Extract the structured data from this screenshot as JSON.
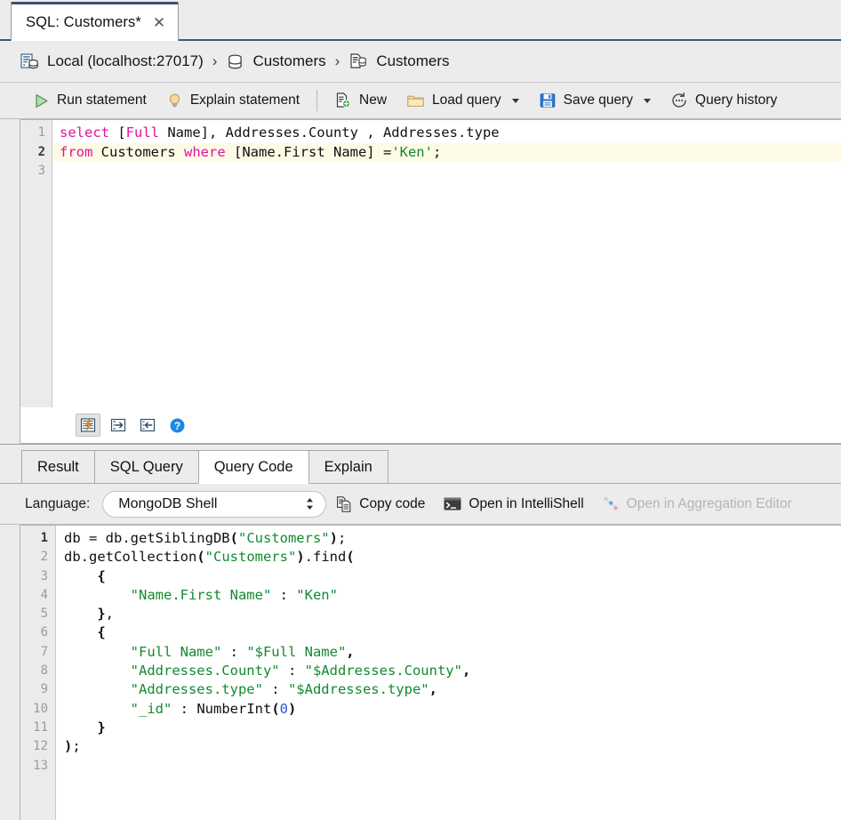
{
  "window": {
    "tab": {
      "label": "SQL: Customers*",
      "close_icon": "close-icon"
    }
  },
  "breadcrumb": {
    "items": [
      {
        "icon": "server-database-icon",
        "label": "Local (localhost:27017)"
      },
      {
        "icon": "database-icon",
        "label": "Customers"
      },
      {
        "icon": "collection-icon",
        "label": "Customers"
      }
    ],
    "separator": "›"
  },
  "toolbar": {
    "run_label": "Run statement",
    "explain_label": "Explain statement",
    "new_label": "New",
    "load_query_label": "Load query",
    "save_query_label": "Save query",
    "query_history_label": "Query history"
  },
  "sql_editor": {
    "line_numbers": [
      "1",
      "2",
      "3"
    ],
    "current_line": 2,
    "lines": [
      [
        {
          "t": "select ",
          "c": "kw"
        },
        {
          "t": "[",
          "c": "brk"
        },
        {
          "t": "Full",
          "c": "kw"
        },
        {
          "t": " Name], Addresses.County , Addresses.type",
          "c": "plain"
        }
      ],
      [
        {
          "t": "from ",
          "c": "kw"
        },
        {
          "t": "Customers ",
          "c": "plain"
        },
        {
          "t": "where ",
          "c": "kw"
        },
        {
          "t": "[Name.First Name] =",
          "c": "plain"
        },
        {
          "t": "'Ken'",
          "c": "str"
        },
        {
          "t": ";",
          "c": "plain"
        }
      ],
      []
    ],
    "footer_icons": [
      {
        "name": "format-query-icon",
        "selected": true
      },
      {
        "name": "indent-right-icon",
        "selected": false
      },
      {
        "name": "indent-left-icon",
        "selected": false
      },
      {
        "name": "help-icon",
        "selected": false
      }
    ]
  },
  "result_panel": {
    "tabs": [
      {
        "label": "Result",
        "active": false
      },
      {
        "label": "SQL Query",
        "active": false
      },
      {
        "label": "Query Code",
        "active": true
      },
      {
        "label": "Explain",
        "active": false
      }
    ],
    "language_label": "Language:",
    "language_value": "MongoDB Shell",
    "actions": [
      {
        "label": "Copy code",
        "icon": "copy-icon",
        "disabled": false
      },
      {
        "label": "Open in IntelliShell",
        "icon": "terminal-icon",
        "disabled": false
      },
      {
        "label": "Open in Aggregation Editor",
        "icon": "aggregation-icon",
        "disabled": true
      }
    ]
  },
  "query_code": {
    "line_numbers": [
      "1",
      "2",
      "3",
      "4",
      "5",
      "6",
      "7",
      "8",
      "9",
      "10",
      "11",
      "12",
      "13"
    ],
    "current_line": 1,
    "lines": [
      [
        {
          "t": "db = db.getSiblingDB",
          "c": "plain"
        },
        {
          "t": "(",
          "c": "bold"
        },
        {
          "t": "\"Customers\"",
          "c": "str"
        },
        {
          "t": ")",
          "c": "bold"
        },
        {
          "t": ";",
          "c": "plain"
        }
      ],
      [
        {
          "t": "db.getCollection",
          "c": "plain"
        },
        {
          "t": "(",
          "c": "bold"
        },
        {
          "t": "\"Customers\"",
          "c": "str"
        },
        {
          "t": ")",
          "c": "bold"
        },
        {
          "t": ".find",
          "c": "plain"
        },
        {
          "t": "(",
          "c": "bold"
        }
      ],
      [
        {
          "t": "    ",
          "c": "plain"
        },
        {
          "t": "{",
          "c": "bold"
        }
      ],
      [
        {
          "t": "        ",
          "c": "plain"
        },
        {
          "t": "\"Name.First Name\"",
          "c": "str"
        },
        {
          "t": " : ",
          "c": "plain"
        },
        {
          "t": "\"Ken\"",
          "c": "str"
        }
      ],
      [
        {
          "t": "    ",
          "c": "plain"
        },
        {
          "t": "}",
          "c": "bold"
        },
        {
          "t": ",",
          "c": "plain"
        }
      ],
      [
        {
          "t": "    ",
          "c": "plain"
        },
        {
          "t": "{",
          "c": "bold"
        }
      ],
      [
        {
          "t": "        ",
          "c": "plain"
        },
        {
          "t": "\"Full Name\"",
          "c": "str"
        },
        {
          "t": " : ",
          "c": "plain"
        },
        {
          "t": "\"$Full Name\"",
          "c": "str"
        },
        {
          "t": ",",
          "c": "bold"
        }
      ],
      [
        {
          "t": "        ",
          "c": "plain"
        },
        {
          "t": "\"Addresses.County\"",
          "c": "str"
        },
        {
          "t": " : ",
          "c": "plain"
        },
        {
          "t": "\"$Addresses.County\"",
          "c": "str"
        },
        {
          "t": ",",
          "c": "bold"
        }
      ],
      [
        {
          "t": "        ",
          "c": "plain"
        },
        {
          "t": "\"Addresses.type\"",
          "c": "str"
        },
        {
          "t": " : ",
          "c": "plain"
        },
        {
          "t": "\"$Addresses.type\"",
          "c": "str"
        },
        {
          "t": ",",
          "c": "bold"
        }
      ],
      [
        {
          "t": "        ",
          "c": "plain"
        },
        {
          "t": "\"_id\"",
          "c": "str"
        },
        {
          "t": " : NumberInt",
          "c": "plain"
        },
        {
          "t": "(",
          "c": "bold"
        },
        {
          "t": "0",
          "c": "num"
        },
        {
          "t": ")",
          "c": "bold"
        }
      ],
      [
        {
          "t": "    ",
          "c": "plain"
        },
        {
          "t": "}",
          "c": "bold"
        }
      ],
      [
        {
          "t": ")",
          "c": "bold"
        },
        {
          "t": ";",
          "c": "plain"
        }
      ],
      []
    ]
  },
  "colors": {
    "accent_tab_top": "#35536f",
    "keyword": "#e0139e",
    "string": "#138a2f",
    "number": "#2a56d6",
    "current_line_bg": "#fdfae6",
    "chrome_bg": "#ececec"
  }
}
